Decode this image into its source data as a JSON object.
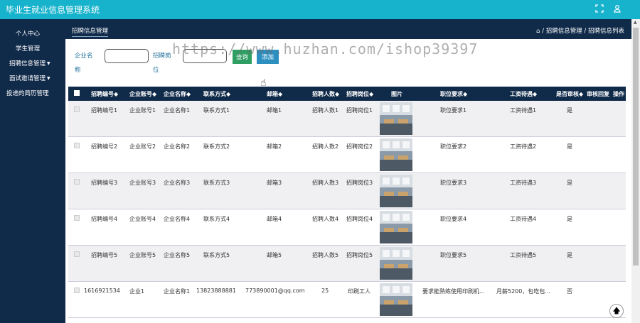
{
  "app": {
    "title": "毕业生就业信息管理系统"
  },
  "topbar_icons": [
    "fullscreen-icon",
    "user-icon"
  ],
  "sidebar": {
    "items": [
      {
        "label": "个人中心",
        "expandable": false
      },
      {
        "label": "学生管理",
        "expandable": false
      },
      {
        "label": "招聘信息管理",
        "expandable": true
      },
      {
        "label": "面试邀请管理",
        "expandable": true
      },
      {
        "label": "投递的简历管理",
        "expandable": false
      }
    ]
  },
  "breadcrumb": {
    "tab": "招聘信息管理",
    "path": "⌂ / 招聘信息管理 / 招聘信息列表"
  },
  "search": {
    "company_label": "企业名称",
    "position_label": "招聘岗位",
    "company_value": "",
    "position_value": "",
    "query_button": "查询",
    "add_button": "添加"
  },
  "watermark": "https://www.huzhan.com/ishop39397",
  "table": {
    "headers": [
      "招聘编号◆",
      "企业账号◆",
      "企业名称◆",
      "联系方式◆",
      "邮箱◆",
      "招聘人数◆",
      "招聘岗位◆",
      "图片",
      "职位要求◆",
      "工资待遇◆",
      "是否审核◆",
      "审核回复",
      "操作"
    ],
    "rows": [
      {
        "id": "招聘编号1",
        "account": "企业账号1",
        "company": "企业名称1",
        "contact": "联系方式1",
        "email": "邮箱1",
        "count": "招聘人数1",
        "position": "招聘岗位1",
        "image": "office-photo",
        "requirement": "职位要求1",
        "salary": "工资待遇1",
        "audited": "是"
      },
      {
        "id": "招聘编号2",
        "account": "企业账号2",
        "company": "企业名称2",
        "contact": "联系方式2",
        "email": "邮箱2",
        "count": "招聘人数2",
        "position": "招聘岗位2",
        "image": "office-photo",
        "requirement": "职位要求2",
        "salary": "工资待遇2",
        "audited": "是"
      },
      {
        "id": "招聘编号3",
        "account": "企业账号3",
        "company": "企业名称3",
        "contact": "联系方式3",
        "email": "邮箱3",
        "count": "招聘人数3",
        "position": "招聘岗位3",
        "image": "office-photo",
        "requirement": "职位要求3",
        "salary": "工资待遇3",
        "audited": "是"
      },
      {
        "id": "招聘编号4",
        "account": "企业账号4",
        "company": "企业名称4",
        "contact": "联系方式4",
        "email": "邮箱4",
        "count": "招聘人数4",
        "position": "招聘岗位4",
        "image": "office-photo",
        "requirement": "职位要求4",
        "salary": "工资待遇4",
        "audited": "是"
      },
      {
        "id": "招聘编号5",
        "account": "企业账号5",
        "company": "企业名称5",
        "contact": "联系方式5",
        "email": "邮箱5",
        "count": "招聘人数5",
        "position": "招聘岗位5",
        "image": "office-photo",
        "requirement": "职位要求5",
        "salary": "工资待遇5",
        "audited": "是"
      },
      {
        "id": "1616921534",
        "account": "企业1",
        "company": "企业名称1",
        "contact": "13823888881",
        "email": "773890001@qq.com",
        "count": "25",
        "position": "印刷工人",
        "image": "office-photo",
        "requirement": "要求能熟练使用印刷机...",
        "salary": "月薪5200，包吃包...",
        "audited": "否"
      }
    ]
  },
  "colors": {
    "topbar": "#17b3cc",
    "sidebar": "#102a4a",
    "query": "#2e9e63",
    "add": "#2d8fc0"
  }
}
